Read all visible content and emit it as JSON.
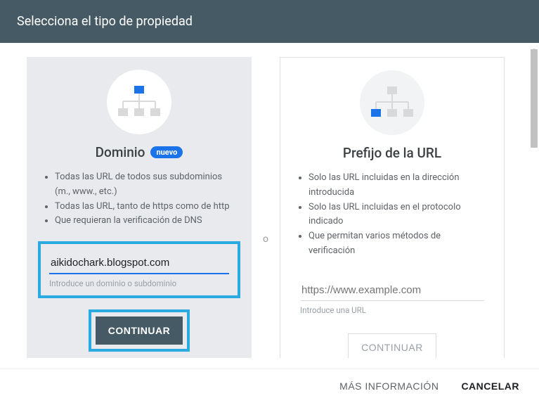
{
  "header": {
    "title": "Selecciona el tipo de propiedad"
  },
  "divider_label": "o",
  "domain_card": {
    "title": "Dominio",
    "badge": "nuevo",
    "bullets": [
      "Todas las URL de todos sus subdominios (m., www., etc.)",
      "Todas las URL, tanto de https como de http",
      "Que requieran la verificación de DNS"
    ],
    "input_value": "aikidochark.blogspot.com",
    "input_helper": "Introduce un dominio o subdominio",
    "continue_label": "CONTINUAR"
  },
  "url_card": {
    "title": "Prefijo de la URL",
    "bullets": [
      "Solo las URL incluidas en la dirección introducida",
      "Solo las URL incluidas en el protocolo indicado",
      "Que permitan varios métodos de verificación"
    ],
    "input_placeholder": "https://www.example.com",
    "input_helper": "Introduce una URL",
    "continue_label": "CONTINUAR"
  },
  "footer": {
    "more_info": "MÁS INFORMACIÓN",
    "cancel": "CANCELAR"
  }
}
